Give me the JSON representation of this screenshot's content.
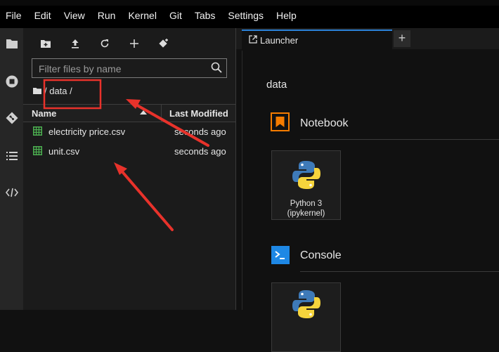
{
  "menubar": {
    "items": [
      "File",
      "Edit",
      "View",
      "Run",
      "Kernel",
      "Git",
      "Tabs",
      "Settings",
      "Help"
    ]
  },
  "activity_bar": {
    "icons": [
      "folder-icon",
      "running-icon",
      "git-icon",
      "table-of-contents-icon",
      "extensions-icon"
    ]
  },
  "file_browser": {
    "toolbar": [
      "new-folder-icon",
      "upload-icon",
      "refresh-icon",
      "new-launcher-icon",
      "git-clone-icon"
    ],
    "filter_placeholder": "Filter files by name",
    "breadcrumb": "/ data /",
    "columns": {
      "name": "Name",
      "modified": "Last Modified"
    },
    "files": [
      {
        "name": "electricity price.csv",
        "modified": "seconds ago"
      },
      {
        "name": "unit.csv",
        "modified": "seconds ago"
      }
    ]
  },
  "tabs": [
    {
      "label": "Launcher"
    }
  ],
  "launcher": {
    "cwd": "data",
    "sections": [
      {
        "title": "Notebook",
        "cards": [
          {
            "label": "Python 3 (ipykernel)"
          }
        ]
      },
      {
        "title": "Console",
        "cards": [
          {
            "label": ""
          }
        ]
      }
    ]
  },
  "colors": {
    "accent": "#2b82d9",
    "annotation": "#e8322b",
    "csv_icon": "#4caf50"
  }
}
